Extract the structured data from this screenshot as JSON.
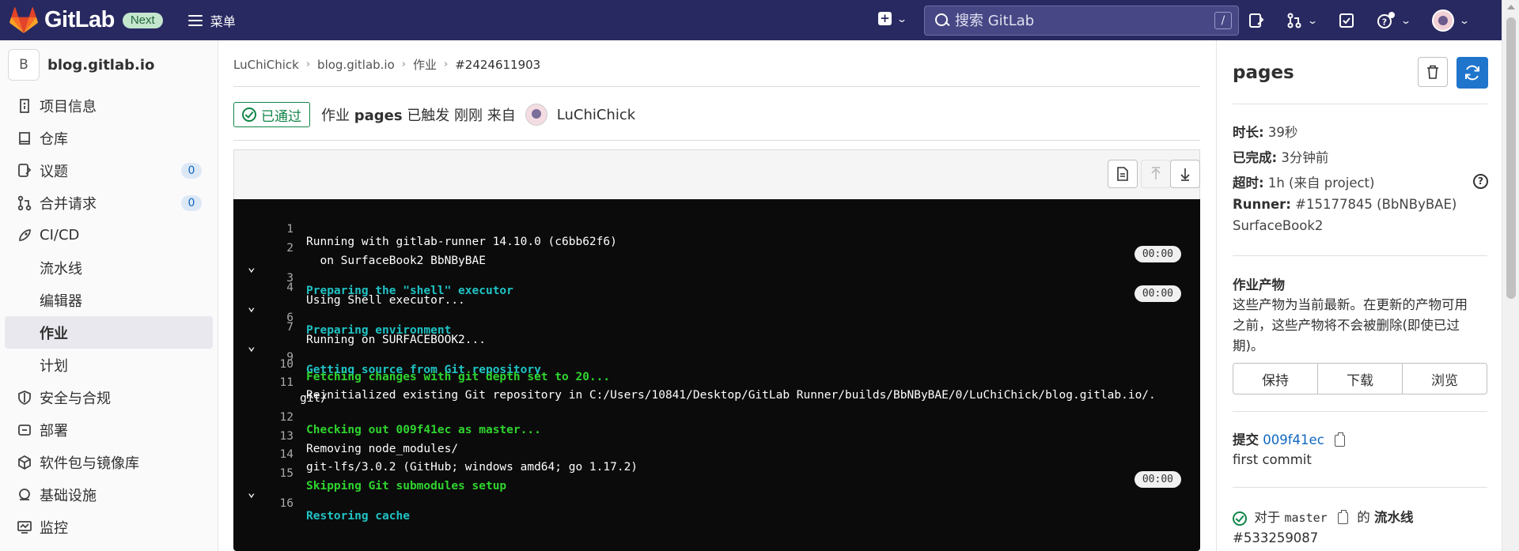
{
  "topbar": {
    "brand": "GitLab",
    "badge": "Next",
    "menu_label": "菜单",
    "search_placeholder": "搜索 GitLab",
    "search_shortcut": "/",
    "colors": {
      "background": "#292961",
      "badge_bg": "#c3e6cd",
      "badge_text": "#24663b"
    }
  },
  "sidebar": {
    "project_initial": "B",
    "project_name": "blog.gitlab.io",
    "items": [
      {
        "label": "项目信息",
        "icon": "info-icon"
      },
      {
        "label": "仓库",
        "icon": "repository-icon"
      },
      {
        "label": "议题",
        "icon": "issues-icon",
        "count": "0"
      },
      {
        "label": "合并请求",
        "icon": "merge-request-icon",
        "count": "0"
      },
      {
        "label": "CI/CD",
        "icon": "rocket-icon"
      },
      {
        "label": "流水线"
      },
      {
        "label": "编辑器"
      },
      {
        "label": "作业",
        "active": true
      },
      {
        "label": "计划"
      },
      {
        "label": "安全与合规",
        "icon": "shield-icon"
      },
      {
        "label": "部署",
        "icon": "deployments-icon"
      },
      {
        "label": "软件包与镜像库",
        "icon": "package-icon"
      },
      {
        "label": "基础设施",
        "icon": "infrastructure-icon"
      },
      {
        "label": "监控",
        "icon": "monitor-icon"
      }
    ]
  },
  "breadcrumb": [
    "LuChiChick",
    "blog.gitlab.io",
    "作业",
    "#2424611903"
  ],
  "job_header": {
    "status": "已通过",
    "prefix": "作业",
    "job_name": "pages",
    "middle": "已触发 刚刚 来自",
    "user": "LuChiChick"
  },
  "log": [
    {
      "num": "1",
      "text": "Running with gitlab-runner 14.10.0 (c6bb62f6)"
    },
    {
      "num": "2",
      "text": "  on SurfaceBook2 BbNByBAE"
    },
    {
      "num": "3",
      "text": "Preparing the \"shell\" executor",
      "type": "section",
      "duration": "00:00"
    },
    {
      "num": "4",
      "text": "Using Shell executor..."
    },
    {
      "num": "6",
      "text": "Preparing environment",
      "type": "section",
      "duration": "00:00"
    },
    {
      "num": "7",
      "text": "Running on SURFACEBOOK2..."
    },
    {
      "num": "9",
      "text": "Getting source from Git repository",
      "type": "section"
    },
    {
      "num": "10",
      "text": "Fetching changes with git depth set to 20...",
      "type": "green"
    },
    {
      "num": "11",
      "text": "Reinitialized existing Git repository in C:/Users/10841/Desktop/GitLab Runner/builds/BbNByBAE/0/LuChiChick/blog.gitlab.io/.",
      "cont": "git/"
    },
    {
      "num": "12",
      "text": "Checking out 009f41ec as master...",
      "type": "green"
    },
    {
      "num": "13",
      "text": "Removing node_modules/"
    },
    {
      "num": "14",
      "text": "git-lfs/3.0.2 (GitHub; windows amd64; go 1.17.2)"
    },
    {
      "num": "15",
      "text": "Skipping Git submodules setup",
      "type": "green"
    },
    {
      "num": "16",
      "text": "Restoring cache",
      "type": "section",
      "duration": "00:00"
    }
  ],
  "right_panel": {
    "title": "pages",
    "duration_label": "时长:",
    "duration_value": "39秒",
    "finished_label": "已完成:",
    "finished_value": "3分钟前",
    "timeout_label": "超时:",
    "timeout_value": "1h (来自 project)",
    "runner_label": "Runner:",
    "runner_value": "#15177845 (BbNByBAE)",
    "runner_name": "SurfaceBook2",
    "artifacts_title": "作业产物",
    "artifacts_line1": "这些产物为当前最新。在更新的产物可用",
    "artifacts_line2": "之前，这些产物将不会被删除(即使已过",
    "artifacts_line3": "期)。",
    "artifact_buttons": [
      "保持",
      "下载",
      "浏览"
    ],
    "commit_label": "提交",
    "commit_sha": "009f41ec",
    "commit_message": "first commit",
    "pipeline_for": "对于",
    "pipeline_branch": "master",
    "pipeline_of": "的",
    "pipeline_label": "流水线",
    "pipeline_id": "#533259087"
  }
}
